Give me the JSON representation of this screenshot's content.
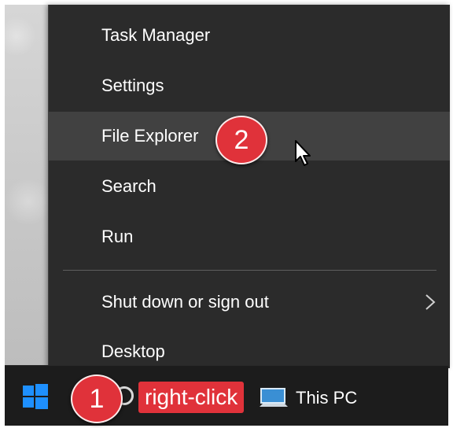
{
  "context_menu": {
    "items": [
      {
        "label": "Task Manager"
      },
      {
        "label": "Settings"
      },
      {
        "label": "File Explorer"
      },
      {
        "label": "Search"
      },
      {
        "label": "Run"
      },
      {
        "label": "Shut down or sign out"
      },
      {
        "label": "Desktop"
      }
    ],
    "hovered_item": "File Explorer"
  },
  "annotations": {
    "step_1": "1",
    "step_2": "2",
    "callout": "right-click"
  },
  "taskbar": {
    "pinned_label": "This PC",
    "start_icon": "windows-start-icon",
    "search_icon": "cortana-circle-icon"
  },
  "colors": {
    "menu_bg": "#2b2b2b",
    "menu_hover": "#414141",
    "taskbar_bg": "#1c1c1c",
    "accent_blue": "#1e90ff",
    "annotation_red": "#e0323a"
  }
}
